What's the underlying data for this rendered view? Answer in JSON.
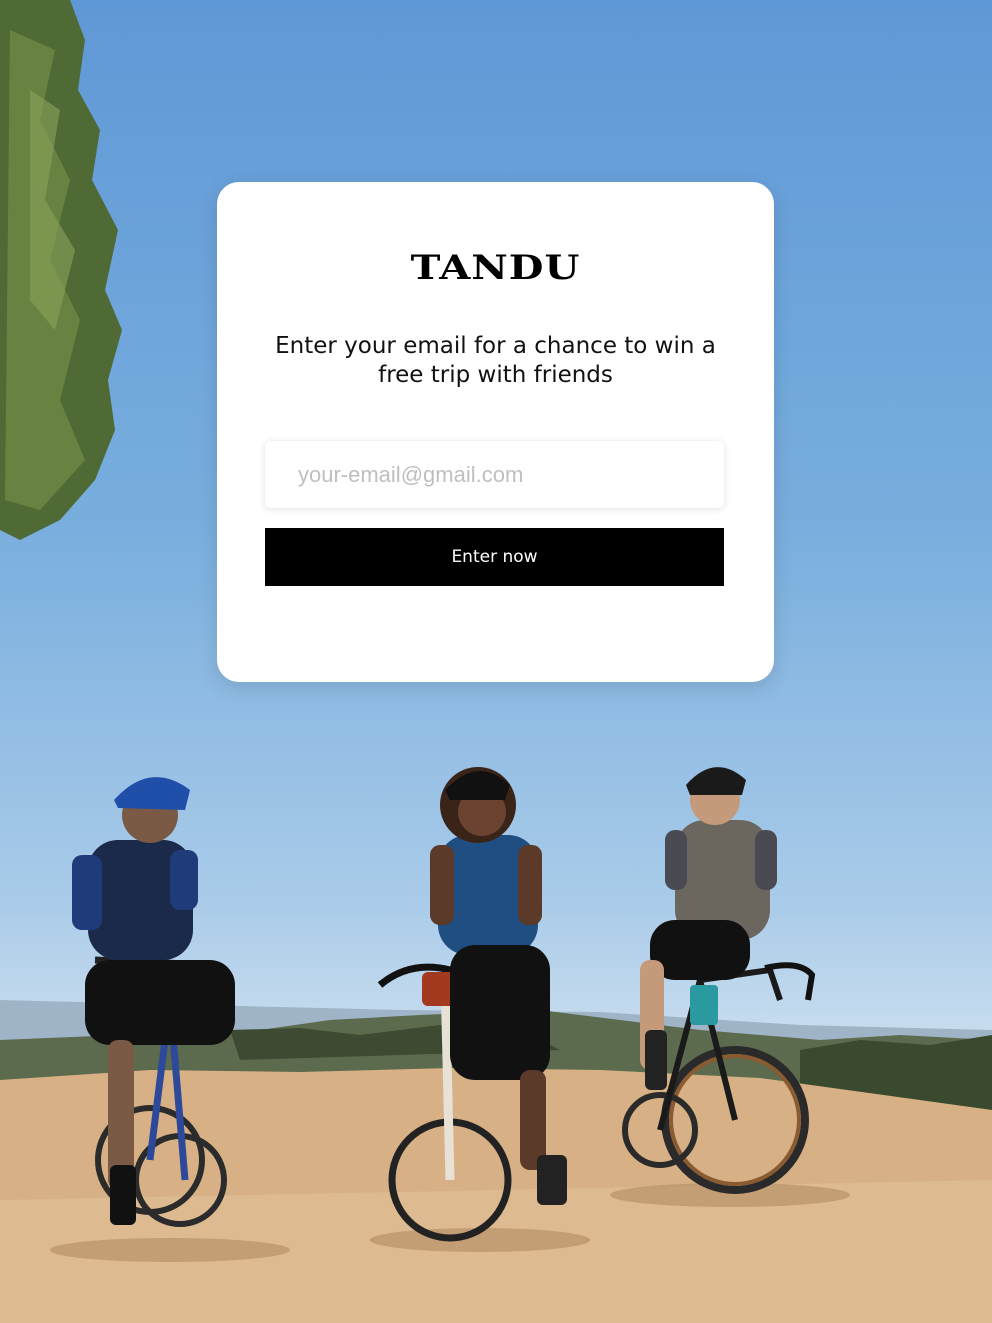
{
  "brand": {
    "logo_text": "TANDU"
  },
  "signup": {
    "headline": "Enter your email for a chance to win a free trip with friends",
    "email_placeholder": "your-email@gmail.com",
    "email_value": "",
    "submit_label": "Enter now"
  },
  "colors": {
    "button_background": "#000000",
    "button_text": "#ffffff",
    "card_background": "#ffffff",
    "placeholder": "#bfbfbf"
  }
}
